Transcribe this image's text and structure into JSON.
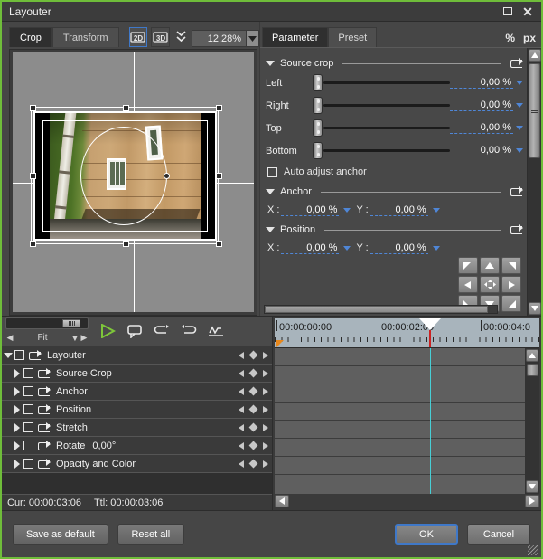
{
  "window": {
    "title": "Layouter",
    "maximize_label": "Maximize",
    "close_label": "Close"
  },
  "toolbar": {
    "tabs": [
      {
        "label": "Crop",
        "active": true
      },
      {
        "label": "Transform",
        "active": false
      }
    ],
    "mode_2d": "2D",
    "mode_3d": "3D",
    "keyframe_icon": "double-chevron-down-icon",
    "zoom_value": "12,28%",
    "zoom_dropdown_icon": "chevron-down-icon"
  },
  "preview": {
    "name": "crop-preview-canvas"
  },
  "parameters": {
    "tabs": [
      {
        "label": "Parameter",
        "active": true
      },
      {
        "label": "Preset",
        "active": false
      }
    ],
    "unit_percent": "%",
    "unit_px": "px",
    "groups": [
      {
        "title": "Source crop",
        "rows": [
          {
            "label": "Left",
            "value": "0,00 %"
          },
          {
            "label": "Right",
            "value": "0,00 %"
          },
          {
            "label": "Top",
            "value": "0,00 %"
          },
          {
            "label": "Bottom",
            "value": "0,00 %"
          }
        ],
        "checkbox": {
          "label": "Auto adjust anchor",
          "checked": false
        }
      },
      {
        "title": "Anchor",
        "x_label": "X :",
        "x_value": "0,00 %",
        "y_label": "Y :",
        "y_value": "0,00 %"
      },
      {
        "title": "Position",
        "x_label": "X :",
        "x_value": "0,00 %",
        "y_label": "Y :",
        "y_value": "0,00 %"
      }
    ],
    "align_pad": [
      "align-top-left",
      "align-top-center",
      "align-top-right",
      "align-middle-left",
      "align-center",
      "align-middle-right",
      "align-bottom-left",
      "align-bottom-center",
      "align-bottom-right"
    ]
  },
  "timeline": {
    "zoom_fit_label": "Fit",
    "tool_icons": [
      "play-icon",
      "preview-monitor-icon",
      "undo-icon",
      "redo-icon",
      "curve-editor-icon"
    ],
    "ruler_labels": [
      "00:00:00:00",
      "00:00:02:00",
      "00:00:04:0"
    ],
    "tree": [
      {
        "label": "Layouter",
        "level": 0,
        "expanded": true,
        "value": ""
      },
      {
        "label": "Source Crop",
        "level": 1,
        "expanded": false,
        "value": ""
      },
      {
        "label": "Anchor",
        "level": 1,
        "expanded": false,
        "value": ""
      },
      {
        "label": "Position",
        "level": 1,
        "expanded": false,
        "value": ""
      },
      {
        "label": "Stretch",
        "level": 1,
        "expanded": false,
        "value": ""
      },
      {
        "label": "Rotate",
        "level": 1,
        "expanded": false,
        "value": "0,00°"
      },
      {
        "label": "Opacity and Color",
        "level": 1,
        "expanded": false,
        "value": ""
      }
    ],
    "status_current": "Cur: 00:00:03:06",
    "status_total": "Ttl: 00:00:03:06"
  },
  "footer": {
    "save_default": "Save as default",
    "reset_all": "Reset all",
    "ok": "OK",
    "cancel": "Cancel"
  }
}
